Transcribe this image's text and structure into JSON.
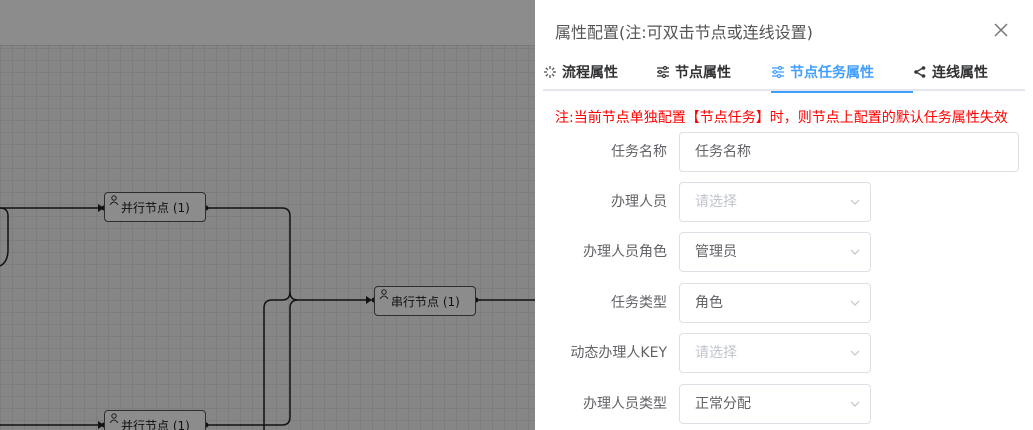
{
  "canvas": {
    "nodes": [
      {
        "label": "并行节点 (1)"
      },
      {
        "label": "串行节点 (1)"
      },
      {
        "label": "并行节点 (1)"
      }
    ]
  },
  "drawer": {
    "title": "属性配置(注:可双击节点或连线设置)",
    "tabs": [
      {
        "label": "流程属性",
        "icon": "loading-icon"
      },
      {
        "label": "节点属性",
        "icon": "sliders-icon"
      },
      {
        "label": "节点任务属性",
        "icon": "sliders-icon",
        "active": true
      },
      {
        "label": "连线属性",
        "icon": "share-icon"
      }
    ],
    "notice": "注:当前节点单独配置【节点任务】时，则节点上配置的默认任务属性失效",
    "form": {
      "task_name": {
        "label": "任务名称",
        "value": "任务名称"
      },
      "handler": {
        "label": "办理人员",
        "placeholder": "请选择"
      },
      "handler_role": {
        "label": "办理人员角色",
        "value": "管理员"
      },
      "task_type": {
        "label": "任务类型",
        "value": "角色"
      },
      "dynamic_key": {
        "label": "动态办理人KEY",
        "placeholder": "请选择"
      },
      "handler_type": {
        "label": "办理人员类型",
        "value": "正常分配"
      }
    }
  },
  "colors": {
    "accent": "#409eff",
    "notice": "#ff0000"
  }
}
